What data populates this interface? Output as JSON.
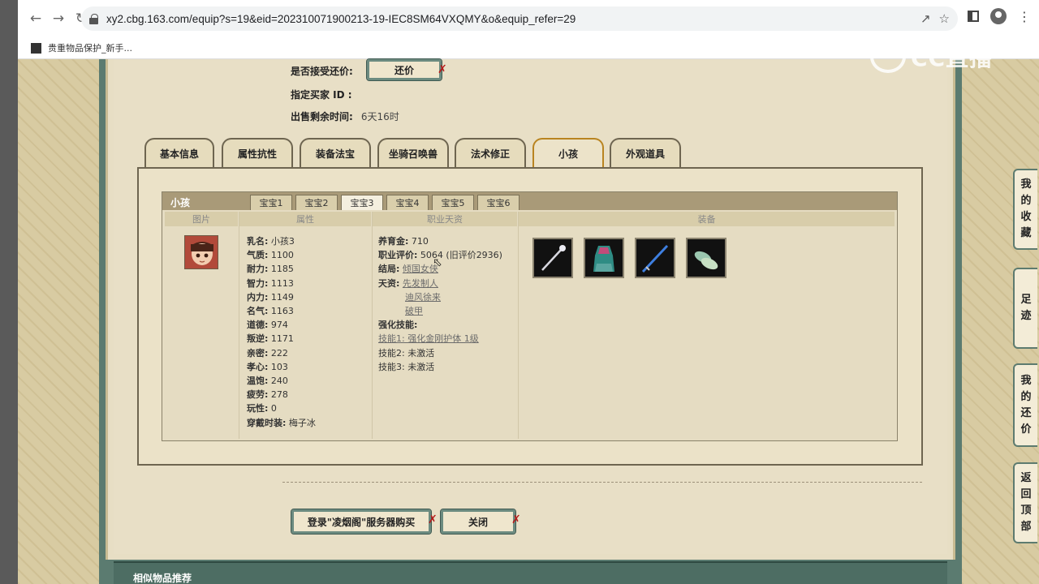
{
  "browser": {
    "url": "xy2.cbg.163.com/equip?s=19&eid=202310071900213-19-IEC8SM64VXQMY&o&equip_refer=29",
    "bookmark_label": "贵重物品保护_新手..."
  },
  "watermark": "CC直播",
  "top_info": {
    "counter_offer_label": "是否接受还价:",
    "counter_offer_button": "还价",
    "buyer_id_label": "指定买家 ID :",
    "time_left_label": "出售剩余时间:",
    "time_left_value": "6天16时"
  },
  "tabs": [
    "基本信息",
    "属性抗性",
    "装备法宝",
    "坐骑召唤兽",
    "法术修正",
    "小孩",
    "外观道具"
  ],
  "child_panel": {
    "title": "小孩",
    "subtabs": [
      "宝宝1",
      "宝宝2",
      "宝宝3",
      "宝宝4",
      "宝宝5",
      "宝宝6"
    ],
    "columns": [
      "图片",
      "属性",
      "职业天资",
      "装备"
    ],
    "attributes": [
      {
        "k": "乳名:",
        "v": "小孩3"
      },
      {
        "k": "气质:",
        "v": "1100"
      },
      {
        "k": "耐力:",
        "v": "1185"
      },
      {
        "k": "智力:",
        "v": "1113"
      },
      {
        "k": "内力:",
        "v": "1149"
      },
      {
        "k": "名气:",
        "v": "1163"
      },
      {
        "k": "道德:",
        "v": "974"
      },
      {
        "k": "叛逆:",
        "v": "1171"
      },
      {
        "k": "亲密:",
        "v": "222"
      },
      {
        "k": "孝心:",
        "v": "103"
      },
      {
        "k": "温饱:",
        "v": "240"
      },
      {
        "k": "疲劳:",
        "v": "278"
      },
      {
        "k": "玩性:",
        "v": "0"
      },
      {
        "k": "穿戴时装:",
        "v": "梅子冰"
      }
    ],
    "career": {
      "fund_label": "养育金:",
      "fund_value": "710",
      "rating_label": "职业评价:",
      "rating_value": "5064 (旧评价2936)",
      "ending_label": "结局:",
      "ending_value": "倾国女侠",
      "talent_label": "天资:",
      "talents": [
        "先发制人",
        "迪风徐来",
        "破甲"
      ],
      "enhance_label": "强化技能:",
      "skill1": "技能1: 强化金刚护体 1级",
      "skill2_label": "技能2:",
      "skill2_value": "未激活",
      "skill3_label": "技能3:",
      "skill3_value": "未激活"
    },
    "equipment": [
      "staff-item",
      "robe-item",
      "sword-item",
      "boots-item"
    ]
  },
  "bottom_buttons": {
    "buy": "登录\"凌烟阁\"服务器购买",
    "close": "关闭"
  },
  "related_title": "相似物品推荐",
  "side_tabs": [
    {
      "name": "side-favorites",
      "chars": [
        "我",
        "的",
        "收",
        "藏"
      ]
    },
    {
      "name": "side-footprint",
      "chars": [
        "足",
        "迹"
      ]
    },
    {
      "name": "side-my-offers",
      "chars": [
        "我",
        "的",
        "还",
        "价"
      ]
    },
    {
      "name": "side-back-top",
      "chars": [
        "返",
        "回",
        "顶",
        "部"
      ]
    }
  ]
}
